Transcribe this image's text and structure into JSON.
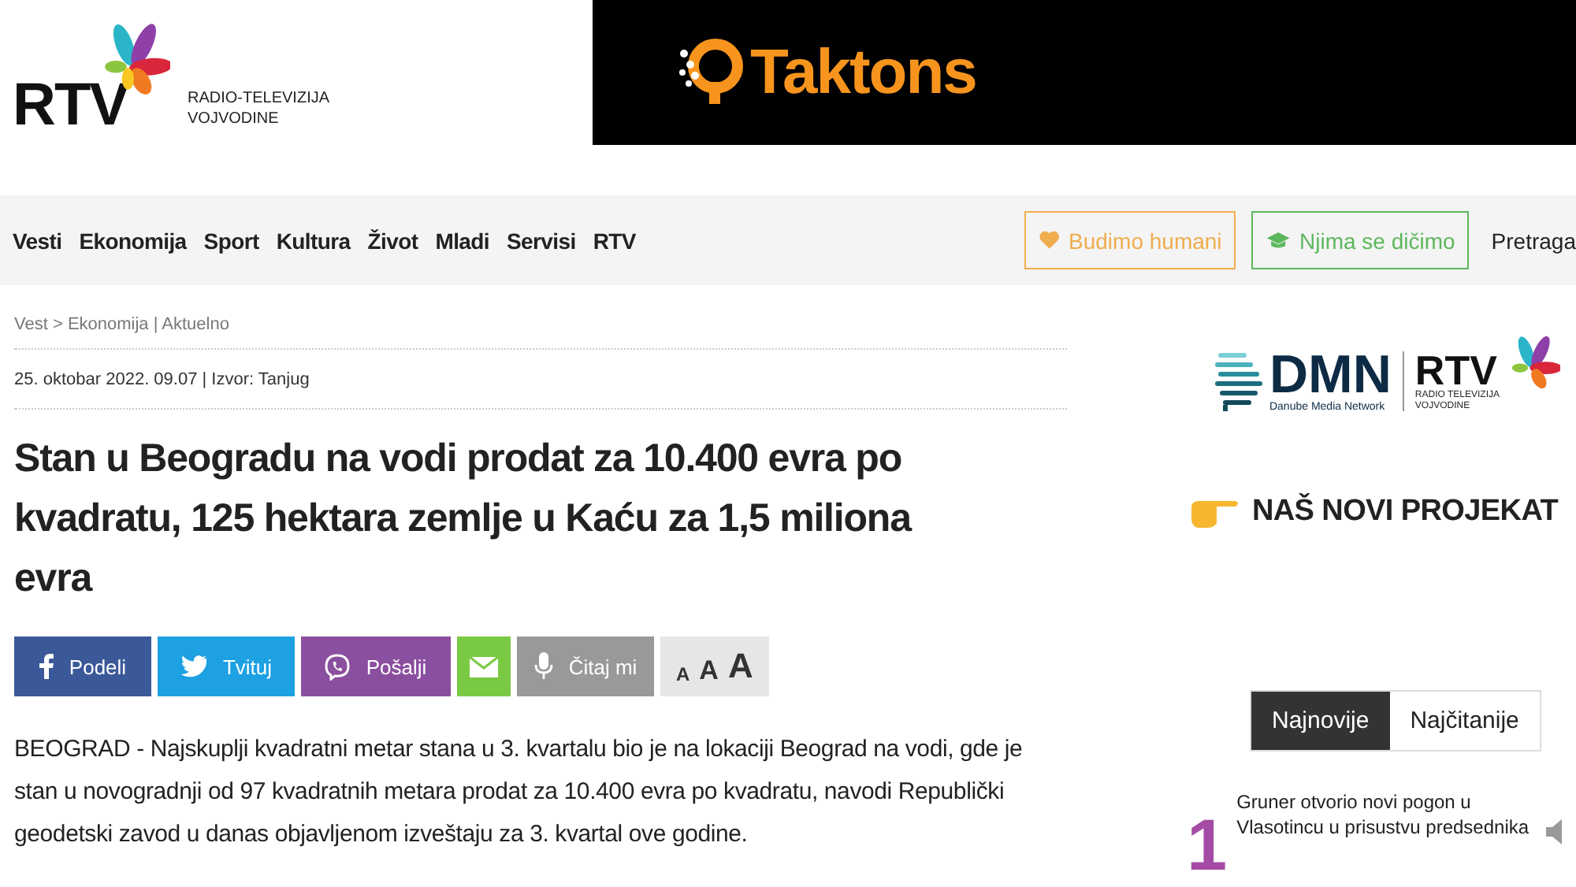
{
  "logo": {
    "mark": "RTV",
    "line1": "RADIO-TELEVIZIJA",
    "line2": "VOJVODINE"
  },
  "ad": {
    "brand": "Taktons"
  },
  "nav": {
    "items": [
      "Vesti",
      "Ekonomija",
      "Sport",
      "Kultura",
      "Život",
      "Mladi",
      "Servisi",
      "RTV"
    ],
    "buttons": [
      {
        "label": "Budimo humani",
        "kind": "heart"
      },
      {
        "label": "Njima se dičimo",
        "kind": "cap"
      }
    ],
    "search": "Pretraga"
  },
  "breadcrumb": "Vest > Ekonomija | Aktuelno",
  "meta": "25. oktobar  2022. 09.07  | Izvor: Tanjug",
  "title": "Stan u Beogradu na vodi prodat za 10.400 evra po kvadratu, 125 hektara zemlje u Kaću za 1,5 miliona evra",
  "share": [
    {
      "kind": "facebook",
      "label": "Podeli"
    },
    {
      "kind": "twitter",
      "label": "Tvituj"
    },
    {
      "kind": "viber",
      "label": "Pošalji"
    },
    {
      "kind": "email"
    },
    {
      "kind": "listen",
      "label": "Čitaj mi"
    }
  ],
  "font_sizes": [
    "A",
    "A",
    "A"
  ],
  "lead": "BEOGRAD - Najskuplji kvadratni metar stana u 3. kvartalu bio je na lokaciji Beograd na vodi, gde je stan u novogradnji od 97 kvadratnih metara prodat za 10.400 evra po kvadratu, navodi Republički geodetski zavod u danas objavljenom izveštaju za 3. kvartal ove godine.",
  "promo": {
    "dmn": "DMN",
    "dmn_sub": "Danube Media Network",
    "rtv": "RTV",
    "rtv_line1": "RADIO TELEVIZIJA",
    "rtv_line2": "VOJVODINE",
    "cta": "NAŠ NOVI PROJEKAT"
  },
  "tabs": [
    {
      "label": "Najnovije",
      "selected": true
    },
    {
      "label": "Najčitanije",
      "selected": false
    }
  ],
  "news": [
    {
      "rank": "1",
      "title": "Gruner otvorio novi pogon u Vlasotincu u prisustvu predsednika"
    }
  ]
}
